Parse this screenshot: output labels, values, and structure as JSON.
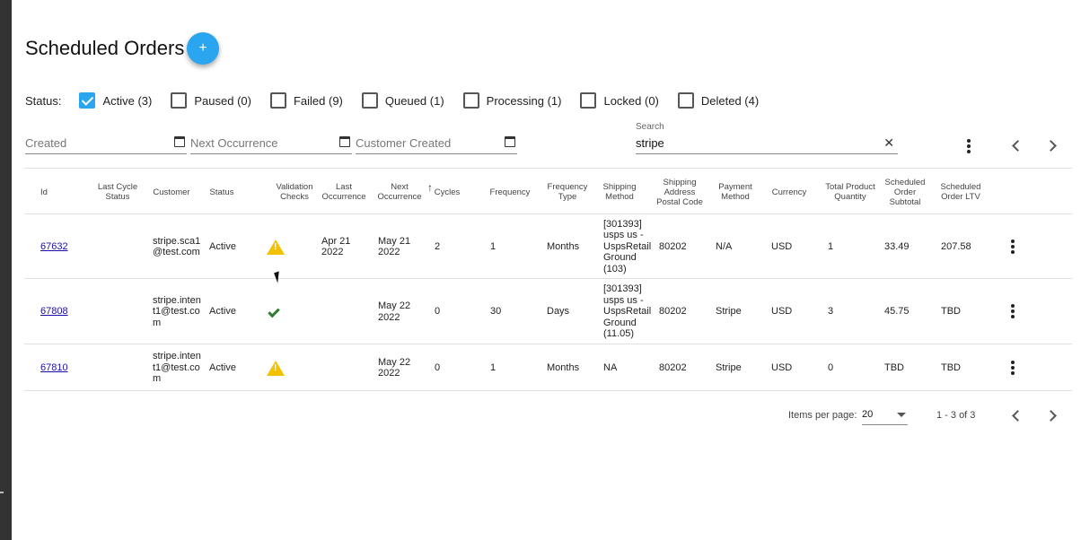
{
  "page": {
    "title": "Scheduled Orders",
    "add_icon": "+"
  },
  "status_filter": {
    "label": "Status:",
    "options": [
      {
        "label": "Active (3)",
        "checked": true
      },
      {
        "label": "Paused (0)",
        "checked": false
      },
      {
        "label": "Failed (9)",
        "checked": false
      },
      {
        "label": "Queued (1)",
        "checked": false
      },
      {
        "label": "Processing (1)",
        "checked": false
      },
      {
        "label": "Locked (0)",
        "checked": false
      },
      {
        "label": "Deleted (4)",
        "checked": false
      }
    ]
  },
  "filters": {
    "created_placeholder": "Created",
    "next_occurrence_placeholder": "Next Occurrence",
    "customer_created_placeholder": "Customer Created",
    "search_label": "Search",
    "search_value": "stripe",
    "clear_icon": "✕"
  },
  "table": {
    "headers": {
      "id": "Id",
      "last_cycle_status": "Last Cycle Status",
      "customer": "Customer",
      "status": "Status",
      "validation_checks": "Validation Checks",
      "last_occurrence": "Last Occurrence",
      "next_occurrence": "Next Occurrence",
      "cycles": "Cycles",
      "frequency": "Frequency",
      "frequency_type": "Frequency Type",
      "shipping_method": "Shipping Method",
      "shipping_address_postal_code": "Shipping Address Postal Code",
      "payment_method": "Payment Method",
      "currency": "Currency",
      "total_product_quantity": "Total Product Quantity",
      "scheduled_order_subtotal": "Scheduled Order Subtotal",
      "scheduled_order_ltv": "Scheduled Order LTV"
    },
    "sort_icon": "↑",
    "rows": [
      {
        "id": "67632",
        "last_cycle_status": "",
        "customer": "stripe.sca1 @test.com",
        "status": "Active",
        "validation": "warning-icon",
        "last_occurrence": "Apr 21 2022",
        "next_occurrence": "May 21 2022",
        "cycles": "2",
        "frequency": "1",
        "frequency_type": "Months",
        "shipping_method": "[301393] usps us - UspsRetail Ground (103)",
        "postal_code": "80202",
        "payment_method": "N/A",
        "currency": "USD",
        "quantity": "1",
        "subtotal": "33.49",
        "ltv": "207.58"
      },
      {
        "id": "67808",
        "last_cycle_status": "",
        "customer": "stripe.inten t1@test.co m",
        "status": "Active",
        "validation": "check-icon",
        "last_occurrence": "",
        "next_occurrence": "May 22 2022",
        "cycles": "0",
        "frequency": "30",
        "frequency_type": "Days",
        "shipping_method": "[301393] usps us - UspsRetail Ground (11.05)",
        "postal_code": "80202",
        "payment_method": "Stripe",
        "currency": "USD",
        "quantity": "3",
        "subtotal": "45.75",
        "ltv": "TBD"
      },
      {
        "id": "67810",
        "last_cycle_status": "",
        "customer": "stripe.inten t1@test.co m",
        "status": "Active",
        "validation": "warning-icon",
        "last_occurrence": "",
        "next_occurrence": "May 22 2022",
        "cycles": "0",
        "frequency": "1",
        "frequency_type": "Months",
        "shipping_method": "NA",
        "postal_code": "80202",
        "payment_method": "Stripe",
        "currency": "USD",
        "quantity": "0",
        "subtotal": "TBD",
        "ltv": "TBD"
      }
    ]
  },
  "pagination": {
    "items_per_page_label": "Items per page:",
    "items_per_page_value": "20",
    "range_label": "1 - 3 of 3"
  },
  "colors": {
    "accent": "#2aa6f0",
    "warning": "#f2c200",
    "valid": "#2e7d32",
    "link": "#1a0dab"
  }
}
